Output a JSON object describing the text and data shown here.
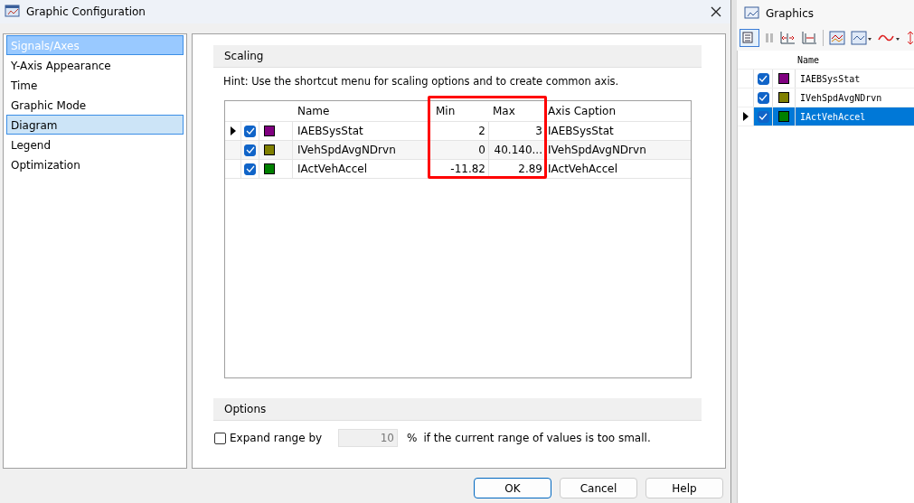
{
  "window": {
    "title": "Graphic Configuration"
  },
  "sidebar": {
    "items": [
      {
        "label": "Signals/Axes",
        "selected": true,
        "hover": false
      },
      {
        "label": "Y-Axis Appearance",
        "selected": false,
        "hover": false
      },
      {
        "label": "Time",
        "selected": false,
        "hover": false
      },
      {
        "label": "Graphic Mode",
        "selected": false,
        "hover": false
      },
      {
        "label": "Diagram",
        "selected": false,
        "hover": true
      },
      {
        "label": "Legend",
        "selected": false,
        "hover": false
      },
      {
        "label": "Optimization",
        "selected": false,
        "hover": false
      }
    ]
  },
  "scaling": {
    "title": "Scaling",
    "hint": "Hint: Use the shortcut menu for scaling options and to create common axis.",
    "table": {
      "highlight_frame": true,
      "columns": [
        "Name",
        "Min",
        "Max",
        "Axis Caption"
      ],
      "rows": [
        {
          "current": true,
          "checked": true,
          "color": "#800080",
          "name": "IAEBSysStat",
          "min": "2",
          "max": "3",
          "caption": "IAEBSysStat"
        },
        {
          "current": false,
          "checked": true,
          "color": "#808000",
          "name": "IVehSpdAvgNDrvn",
          "min": "0",
          "max": "40.140...",
          "caption": "IVehSpdAvgNDrvn"
        },
        {
          "current": false,
          "checked": true,
          "color": "#008000",
          "name": "IActVehAccel",
          "min": "-11.82",
          "max": "2.89",
          "caption": "IActVehAccel"
        }
      ]
    }
  },
  "options": {
    "title": "Options",
    "expand": {
      "checked": false,
      "label": "Expand range by",
      "value": "10",
      "unit": "%",
      "suffix": "if the current range of values is too small."
    }
  },
  "buttons": [
    {
      "label": "OK",
      "default": true
    },
    {
      "label": "Cancel",
      "default": false
    },
    {
      "label": "Help",
      "default": false
    }
  ],
  "graphics": {
    "title": "Graphics",
    "column": "Name",
    "rows": [
      {
        "current": false,
        "selected": false,
        "checked": true,
        "color": "#800080",
        "name": "IAEBSysStat"
      },
      {
        "current": false,
        "selected": false,
        "checked": true,
        "color": "#808000",
        "name": "IVehSpdAvgNDrvn"
      },
      {
        "current": true,
        "selected": true,
        "checked": true,
        "color": "#008000",
        "name": "IActVehAccel"
      }
    ]
  }
}
